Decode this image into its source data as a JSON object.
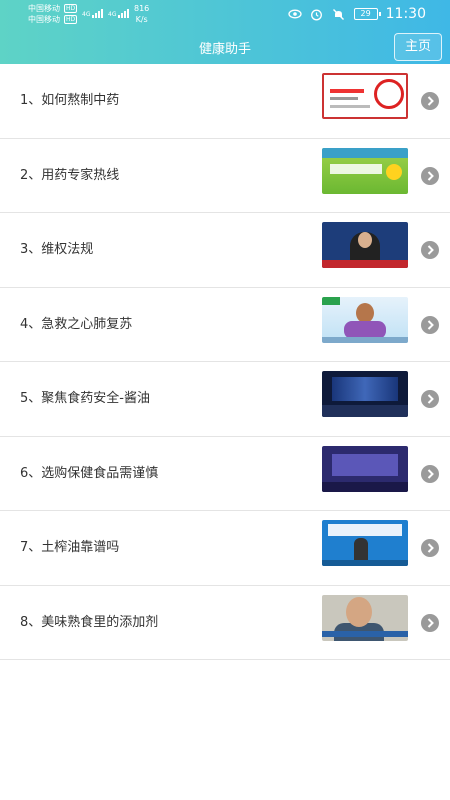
{
  "status_bar": {
    "carrier_1": "中国移动",
    "carrier_2": "中国移动",
    "hd_badge": "HD",
    "net_type": "4G",
    "net_speed_value": "816",
    "net_speed_unit": "K/s",
    "battery": "29",
    "time": "11:30"
  },
  "header": {
    "title": "健康助手",
    "home_button": "主页",
    "gradient_start": "#5ed3c6",
    "gradient_end": "#3fb8e6"
  },
  "list": {
    "items": [
      {
        "label": "1、如何熬制中药",
        "thumb_icon": "thumbnail-herbal-medicine"
      },
      {
        "label": "2、用药专家热线",
        "thumb_icon": "thumbnail-hotline"
      },
      {
        "label": "3、维权法规",
        "thumb_icon": "thumbnail-news-anchor"
      },
      {
        "label": "4、急救之心肺复苏",
        "thumb_icon": "thumbnail-cpr-cartoon"
      },
      {
        "label": "5、聚焦食药安全-酱油",
        "thumb_icon": "thumbnail-studio"
      },
      {
        "label": "6、选购保健食品需谨慎",
        "thumb_icon": "thumbnail-studio-purple"
      },
      {
        "label": "7、土榨油靠谱吗",
        "thumb_icon": "thumbnail-tv-show"
      },
      {
        "label": "8、美味熟食里的添加剂",
        "thumb_icon": "thumbnail-interview"
      }
    ]
  }
}
